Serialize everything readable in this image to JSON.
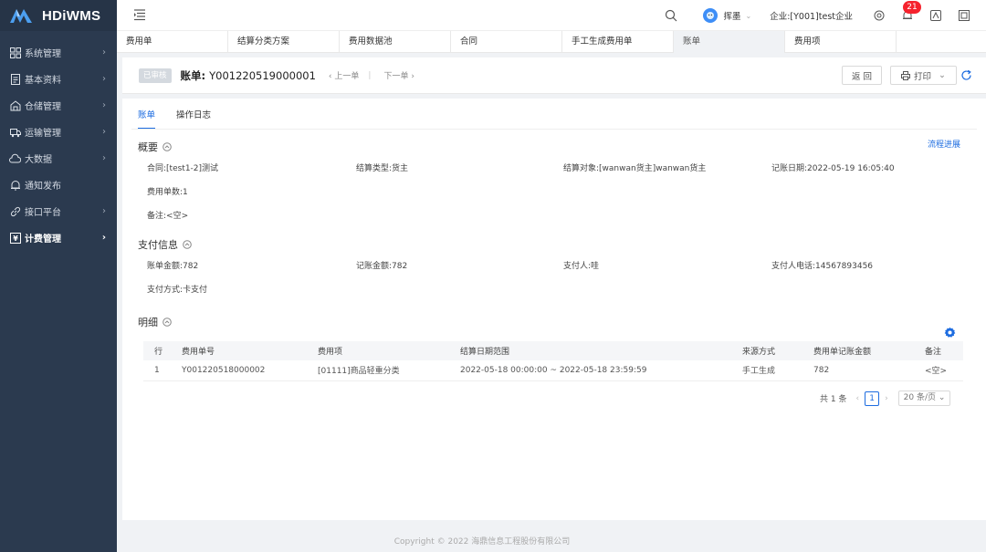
{
  "app": {
    "name": "HDiWMS"
  },
  "sidebar": {
    "items": [
      {
        "label": "系统管理",
        "icon": "grid-icon"
      },
      {
        "label": "基本资料",
        "icon": "document-icon"
      },
      {
        "label": "仓储管理",
        "icon": "warehouse-icon"
      },
      {
        "label": "运输管理",
        "icon": "truck-icon"
      },
      {
        "label": "大数据",
        "icon": "cloud-icon"
      },
      {
        "label": "通知发布",
        "icon": "bell-icon"
      },
      {
        "label": "接口平台",
        "icon": "link-icon"
      },
      {
        "label": "计费管理",
        "icon": "billing-icon",
        "active": true
      }
    ]
  },
  "header": {
    "user": "挥墨",
    "company": "企业:[Y001]test企业",
    "notifications": "21"
  },
  "tabs": [
    "费用单",
    "结算分类方案",
    "费用数据池",
    "合同",
    "手工生成费用单",
    "账单",
    "费用项"
  ],
  "toolbar": {
    "status": "已审核",
    "bill_label": "账单:",
    "bill_no": "Y001220519000001",
    "prev": "上一单",
    "separator": "|",
    "next": "下一单",
    "back": "返 回",
    "print": "打印"
  },
  "subtabs": [
    "账单",
    "操作日志"
  ],
  "overview": {
    "title": "概要",
    "flow_link": "流程进展",
    "contract": "合同:[test1-2]测试",
    "settle_type": "结算类型:货主",
    "settle_target": "结算对象:[wanwan货主]wanwan货主",
    "record_date": "记账日期:2022-05-19 16:05:40",
    "fee_count": "费用单数:1",
    "remark": "备注:<空>"
  },
  "payment": {
    "title": "支付信息",
    "bill_amount": "账单金额:782",
    "record_amount": "记账金额:782",
    "payer": "支付人:哇",
    "payer_phone": "支付人电话:14567893456",
    "pay_method": "支付方式:卡支付"
  },
  "detail": {
    "title": "明细",
    "columns": [
      "行",
      "费用单号",
      "费用项",
      "结算日期范围",
      "来源方式",
      "费用单记账金额",
      "备注"
    ],
    "rows": [
      {
        "line": "1",
        "fee_no": "Y001220518000002",
        "fee_item": "[01111]商品轻重分类",
        "date_range": "2022-05-18 00:00:00 ~ 2022-05-18 23:59:59",
        "source": "手工生成",
        "amount": "782",
        "remark": "<空>"
      }
    ]
  },
  "pager": {
    "total": "共 1 条",
    "page": "1",
    "size": "20 条/页"
  },
  "footer": {
    "copyright": "Copyright © 2022 海鼎信息工程股份有限公司"
  }
}
